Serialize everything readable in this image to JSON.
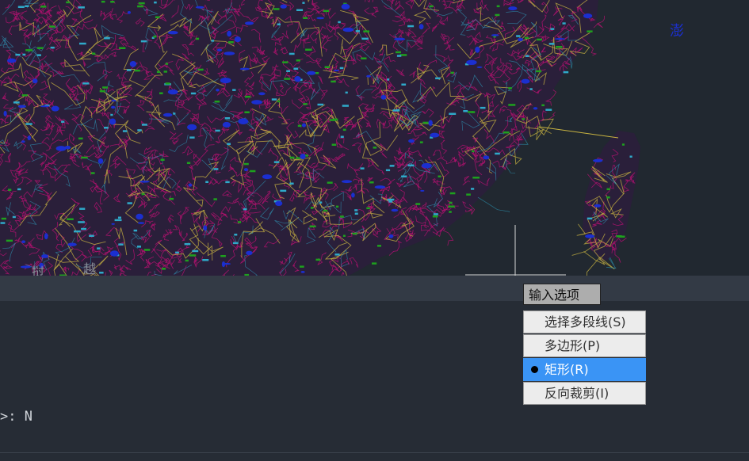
{
  "map": {
    "labels": {
      "laos": "挝",
      "vietnam": "越",
      "ocean": "澎"
    }
  },
  "prompt": {
    "title": "输入选项"
  },
  "menu": {
    "items": [
      {
        "label": "选择多段线(S)",
        "selected": false
      },
      {
        "label": "多边形(P)",
        "selected": false
      },
      {
        "label": "矩形(R)",
        "selected": true
      },
      {
        "label": "反向裁剪(I)",
        "selected": false
      }
    ]
  },
  "command": {
    "text": ">: N"
  },
  "colors": {
    "canvas_bg": "#212830",
    "boundary": "#b0126e",
    "road_major": "#c9b441",
    "road_minor": "#2fa9c9",
    "water": "#1b2fd0",
    "green_labels": "#1ea01e",
    "menu_highlight": "#3a94f5"
  },
  "icons": [
    "bullet-icon",
    "crosshair-icon"
  ]
}
